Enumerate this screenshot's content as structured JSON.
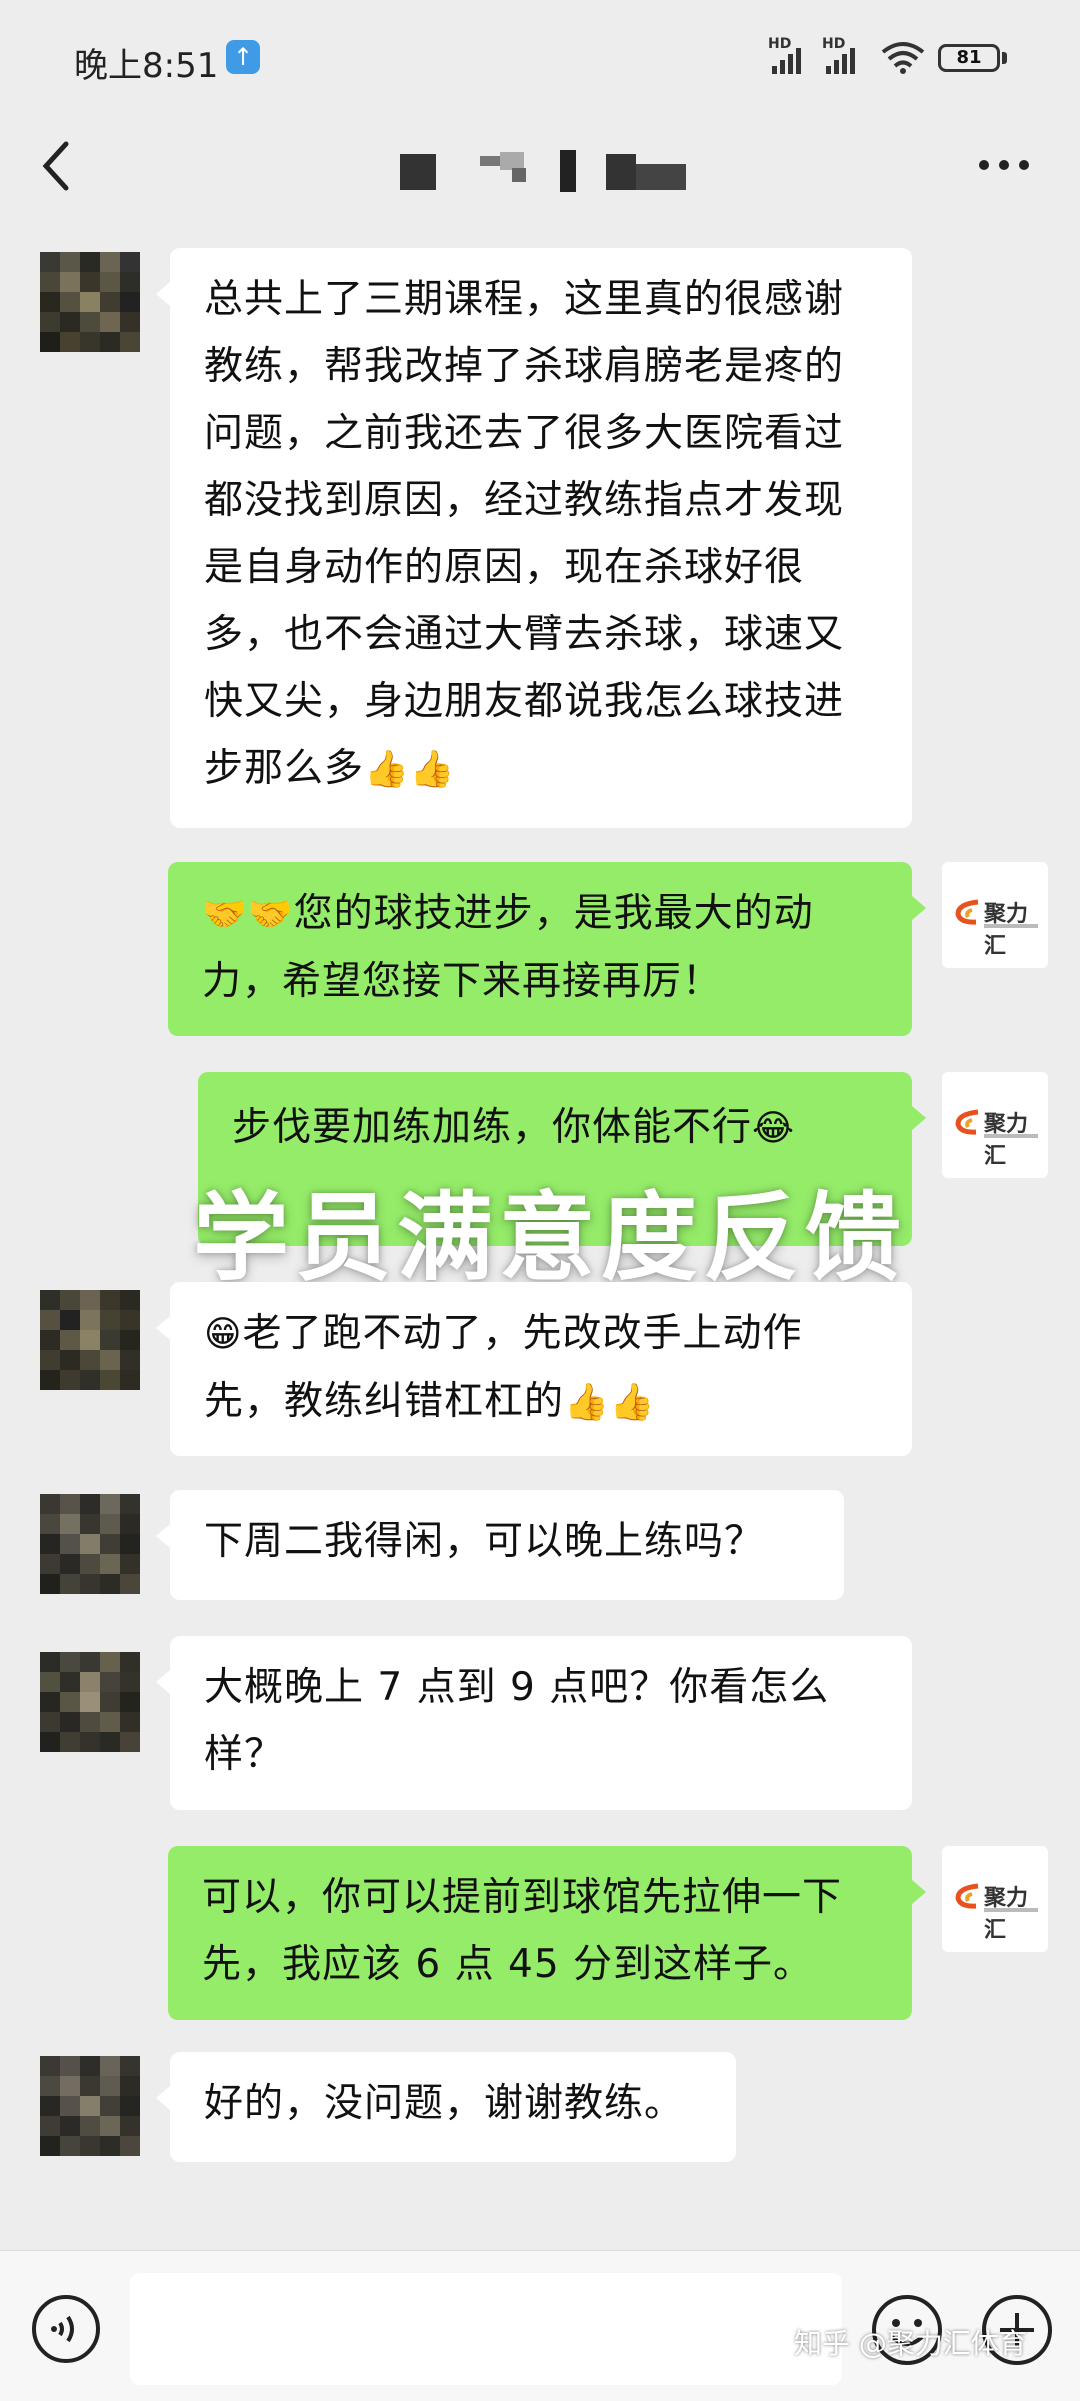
{
  "status_bar": {
    "time": "晚上8:51",
    "hd_label": "HD",
    "battery": "81"
  },
  "chat": {
    "title_masked": true
  },
  "messages": [
    {
      "side": "in",
      "text": "总共上了三期课程，这里真的很感谢教练，帮我改掉了杀球肩膀老是疼的问题，之前我还去了很多大医院看过都没找到原因，经过教练指点才发现是自身动作的原因，现在杀球好很多，也不会通过大臂去杀球，球速又快又尖，身边朋友都说我怎么球技进步那么多",
      "emoji_suffix": "👍👍"
    },
    {
      "side": "out",
      "emoji_prefix": "🤝🤝",
      "text": "您的球技进步，是我最大的动力，希望您接下来再接再厉！"
    },
    {
      "side": "out",
      "text": "步伐要加练加练，你体能不行",
      "emoji_suffix": "😂"
    },
    {
      "side": "in",
      "emoji_prefix": "😁",
      "text": "老了跑不动了，先改改手上动作先，教练纠错杠杠的",
      "emoji_suffix": "👍👍"
    },
    {
      "side": "in",
      "text": "下周二我得闲，可以晚上练吗？"
    },
    {
      "side": "in",
      "text": "大概晚上 7 点到 9 点吧？你看怎么样？"
    },
    {
      "side": "out",
      "text": "可以，你可以提前到球馆先拉伸一下先，我应该 6 点 45 分到这样子。"
    },
    {
      "side": "in",
      "text": "好的，没问题，谢谢教练。"
    }
  ],
  "coach_avatar_text": "聚力汇",
  "overlay_title": "学员满意度反馈",
  "watermark": "知乎 @聚力汇体育",
  "colors": {
    "background": "#ededed",
    "incoming_bubble": "#ffffff",
    "outgoing_bubble": "#95ec69",
    "badge_blue": "#3f9be6"
  },
  "icons": [
    "back-icon",
    "more-icon",
    "voice-icon",
    "emoji-icon",
    "plus-icon",
    "wifi-icon",
    "signal-icon",
    "battery-icon",
    "upload-icon"
  ]
}
